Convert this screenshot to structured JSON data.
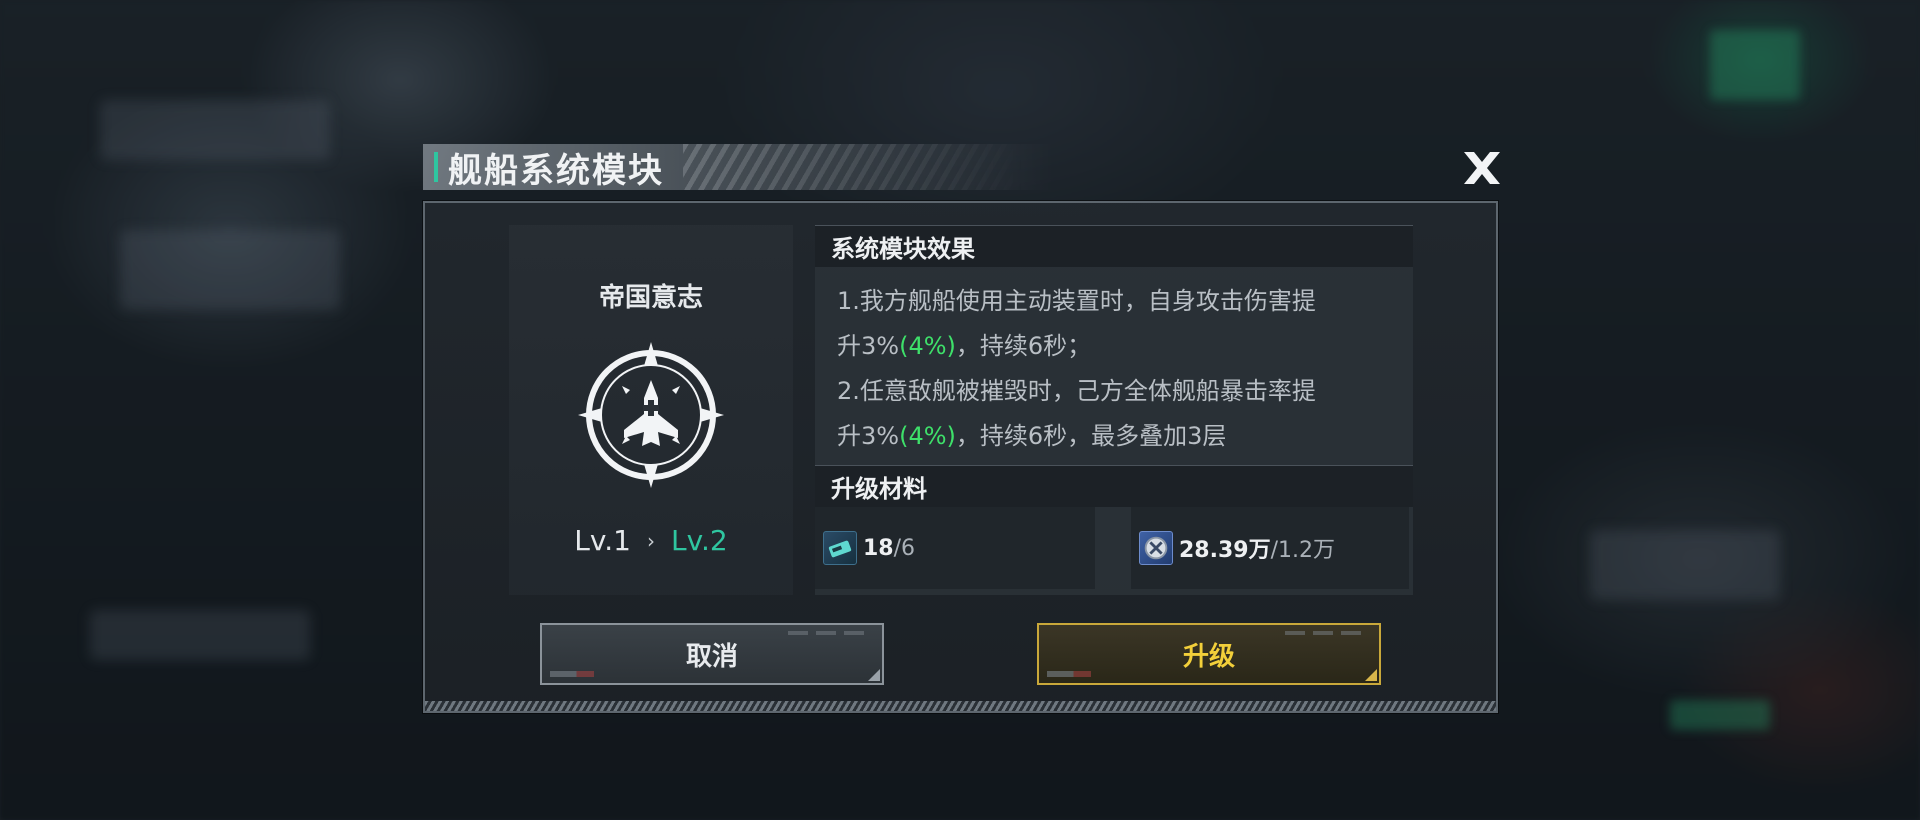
{
  "dialog": {
    "title": "舰船系统模块",
    "accent_color": "#2fc6a0"
  },
  "module": {
    "name": "帝国意志",
    "icon": "ship-crosshair-emblem-icon",
    "level_current": "Lv.1",
    "level_arrow": "›",
    "level_next": "Lv.2"
  },
  "effect": {
    "header": "系统模块效果",
    "line1_a": "1.我方舰船使用主动装置时，自身攻击伤害提",
    "line1_b_pre": "升3%",
    "line1_b_hl": "(4%)",
    "line1_b_post": "，持续6秒；",
    "line2_a": "2.任意敌舰被摧毁时，己方全体舰船暴击率提",
    "line2_b_pre": "升3%",
    "line2_b_hl": "(4%)",
    "line2_b_post": "，持续6秒，最多叠加3层",
    "highlight_color": "#3ee06a"
  },
  "materials": {
    "header": "升级材料",
    "items": [
      {
        "icon": "module-chip-icon",
        "have": "18",
        "need": "/6"
      },
      {
        "icon": "credit-coin-icon",
        "have": "28.39万",
        "need": "/1.2万"
      }
    ]
  },
  "buttons": {
    "cancel": "取消",
    "upgrade": "升级",
    "upgrade_color": "#f2cf3a"
  }
}
